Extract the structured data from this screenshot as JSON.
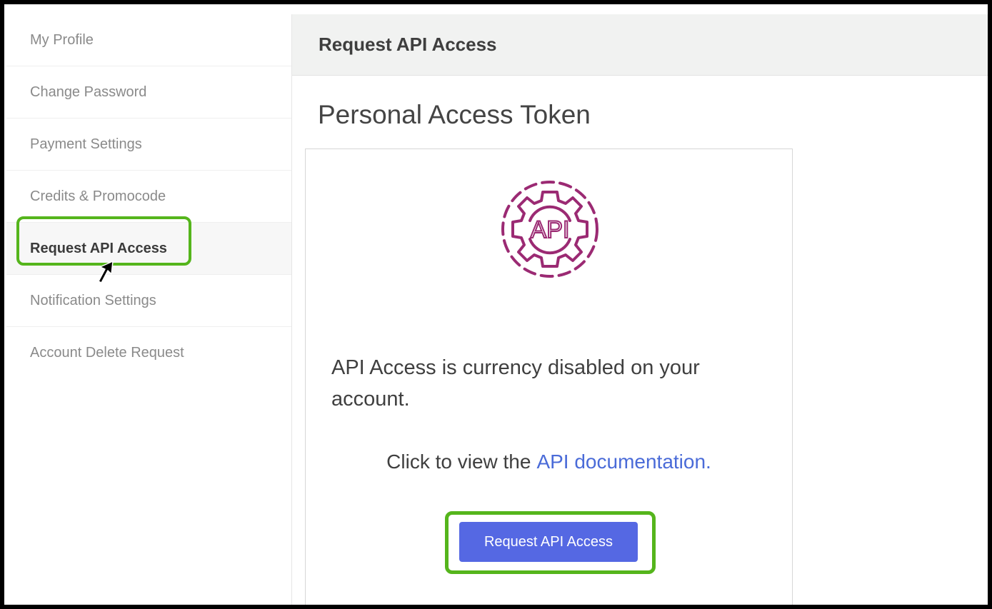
{
  "sidebar": {
    "items": [
      {
        "label": "My Profile"
      },
      {
        "label": "Change Password"
      },
      {
        "label": "Payment Settings"
      },
      {
        "label": "Credits & Promocode"
      },
      {
        "label": "Request API Access"
      },
      {
        "label": "Notification Settings"
      },
      {
        "label": "Account Delete Request"
      }
    ],
    "active_index": 4
  },
  "header": {
    "title": "Request API Access"
  },
  "main": {
    "title": "Personal Access Token",
    "icon": {
      "name": "api-gear-icon",
      "text": "API",
      "color": "#9b2a73"
    },
    "message": "API Access is currency disabled on your account.",
    "doc_prefix": "Click to view the",
    "doc_link": "API documentation.",
    "button_label": "Request API Access"
  },
  "colors": {
    "accent_button": "#5568e3",
    "link": "#4a6bd8",
    "highlight": "#55b51c"
  }
}
